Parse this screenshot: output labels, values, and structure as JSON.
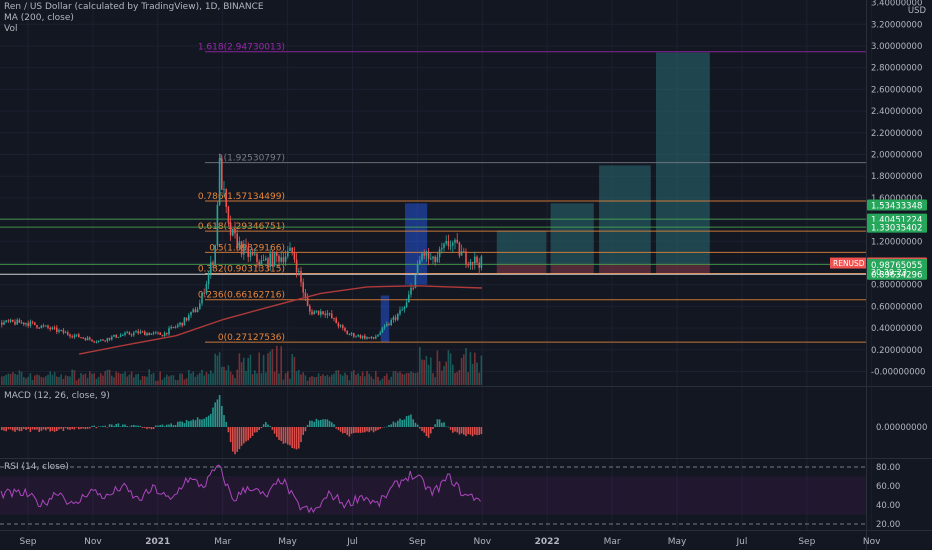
{
  "header": {
    "symbol_line": "Ren / US Dollar (calculated by TradingView), 1D, BINANCE",
    "ma_line": "MA (200, close)",
    "vol_line": "Vol"
  },
  "macd_title": "MACD (12, 26, close, 9)",
  "rsi_title": "RSI (14, close)",
  "colors": {
    "background": "#131722",
    "up": "#26a69a",
    "down": "#ef5350",
    "ma": "#b03a3a",
    "fib": "#e8863a",
    "green_line": "#4caf50",
    "target_box": "#2f7f86",
    "rsi": "#9c27b0",
    "entry_box": "#2962ff",
    "price_label": "#ef5350",
    "level_label_green": "#26a65b"
  },
  "chart_data": [
    {
      "type": "candlestick",
      "title": "",
      "ylabel": "USD",
      "ylim": [
        -0.05,
        3.4
      ],
      "y_ticks": [
        "3.40000000",
        "3.20000000",
        "3.00000000",
        "2.80000000",
        "2.60000000",
        "2.40000000",
        "2.20000000",
        "2.00000000",
        "1.80000000",
        "1.60000000",
        "1.40000000",
        "1.20000000",
        "1.00000000",
        "0.80000000",
        "0.60000000",
        "0.40000000",
        "0.20000000",
        "-0.00000000"
      ],
      "x_ticks": [
        "Sep",
        "Nov",
        "2021",
        "Mar",
        "May",
        "Jul",
        "Sep",
        "Nov",
        "2022",
        "Mar",
        "May",
        "Jul",
        "Sep",
        "Nov"
      ],
      "price_path": [
        [
          "2020-08-25",
          0.45
        ],
        [
          "2020-09-15",
          0.4
        ],
        [
          "2020-10-10",
          0.33
        ],
        [
          "2020-11-01",
          0.28
        ],
        [
          "2020-11-20",
          0.33
        ],
        [
          "2020-12-10",
          0.36
        ],
        [
          "2021-01-01",
          0.34
        ],
        [
          "2021-01-20",
          0.45
        ],
        [
          "2021-02-05",
          0.6
        ],
        [
          "2021-02-20",
          1.1
        ],
        [
          "2021-02-24",
          1.92
        ],
        [
          "2021-03-05",
          1.3
        ],
        [
          "2021-03-20",
          1.1
        ],
        [
          "2021-04-05",
          1.0
        ],
        [
          "2021-04-20",
          1.05
        ],
        [
          "2021-05-05",
          1.1
        ],
        [
          "2021-05-20",
          0.55
        ],
        [
          "2021-06-05",
          0.55
        ],
        [
          "2021-06-25",
          0.35
        ],
        [
          "2021-07-20",
          0.3
        ],
        [
          "2021-08-05",
          0.45
        ],
        [
          "2021-08-20",
          0.6
        ],
        [
          "2021-09-05",
          1.1
        ],
        [
          "2021-09-15",
          1.0
        ],
        [
          "2021-10-01",
          1.2
        ],
        [
          "2021-10-15",
          1.05
        ],
        [
          "2021-11-01",
          1.0
        ]
      ],
      "ma_path": [
        [
          "2020-10-15",
          0.16
        ],
        [
          "2020-12-01",
          0.25
        ],
        [
          "2021-01-15",
          0.33
        ],
        [
          "2021-03-01",
          0.48
        ],
        [
          "2021-04-15",
          0.6
        ],
        [
          "2021-06-01",
          0.72
        ],
        [
          "2021-07-15",
          0.78
        ],
        [
          "2021-09-01",
          0.79
        ],
        [
          "2021-10-01",
          0.78
        ],
        [
          "2021-11-01",
          0.77
        ]
      ],
      "fibonacci": [
        {
          "label": "0(0.27127536)",
          "value": 0.27127536
        },
        {
          "label": "0.236(0.66162716)",
          "value": 0.66162716
        },
        {
          "label": "0.382(0.90313315)",
          "value": 0.90313315
        },
        {
          "label": "0.5(1.09829166)",
          "value": 1.09829166
        },
        {
          "label": "0.618(1.29346751)",
          "value": 1.29346751
        },
        {
          "label": "0.786(1.57134499)",
          "value": 1.57134499
        },
        {
          "label": "1(1.92530797)",
          "value": 1.92530797
        },
        {
          "label": "1.618(2.94730013)",
          "value": 2.94730013
        }
      ],
      "horizontal_lines": [
        {
          "value": 1.40451224,
          "color": "#4caf50"
        },
        {
          "value": 1.33035402,
          "color": "#4caf50"
        },
        {
          "value": 0.98765055,
          "color": "#4caf50"
        },
        {
          "value": 0.89634296,
          "color": "#ffffff"
        }
      ],
      "price_labels": [
        {
          "text": "1.53433348",
          "value": 1.53433348,
          "color": "#26a65b"
        },
        {
          "text": "1.40451224",
          "value": 1.40451224,
          "color": "#26a65b"
        },
        {
          "text": "1.33035402",
          "value": 1.33035402,
          "color": "#26a65b"
        },
        {
          "text": "0.99954296",
          "value": 0.99954296,
          "color": "#ef5350"
        },
        {
          "text": "0.98765055",
          "value": 0.98765055,
          "color": "#26a65b"
        },
        {
          "text": "0.89634296",
          "value": 0.89634296,
          "color": "#26a65b"
        }
      ],
      "current_price": {
        "symbol": "RENUSD",
        "value": "0.99954296",
        "countdown": "20:39:23"
      },
      "entry_zone": {
        "x_start": "2021-07-28",
        "x_end": "2021-08-05",
        "low": 0.27,
        "high": 0.7
      },
      "entry_zone_2": {
        "x_start": "2021-08-20",
        "x_end": "2021-09-10",
        "low": 0.8,
        "high": 1.55
      },
      "target_boxes": [
        {
          "x_start": "2021-11-15",
          "x_end": "2022-01-01",
          "top": 1.3
        },
        {
          "x_start": "2022-01-05",
          "x_end": "2022-02-15",
          "top": 1.55
        },
        {
          "x_start": "2022-02-20",
          "x_end": "2022-04-10",
          "top": 1.9
        },
        {
          "x_start": "2022-04-15",
          "x_end": "2022-06-05",
          "top": 2.94
        }
      ],
      "target_floor": 0.99,
      "stop_floor": 0.9
    },
    {
      "type": "histogram",
      "title": "MACD (12, 26, close, 9)",
      "y_ticks": [
        "0.00000000"
      ],
      "values_path": [
        [
          "2020-08-25",
          -0.03
        ],
        [
          "2020-09-20",
          -0.03
        ],
        [
          "2020-10-20",
          -0.01
        ],
        [
          "2020-11-20",
          0.02
        ],
        [
          "2020-12-20",
          -0.01
        ],
        [
          "2021-01-20",
          0.04
        ],
        [
          "2021-02-15",
          0.1
        ],
        [
          "2021-02-24",
          0.3
        ],
        [
          "2021-03-10",
          -0.25
        ],
        [
          "2021-03-25",
          -0.1
        ],
        [
          "2021-04-10",
          0.05
        ],
        [
          "2021-04-25",
          -0.15
        ],
        [
          "2021-05-10",
          -0.2
        ],
        [
          "2021-05-20",
          0.05
        ],
        [
          "2021-06-05",
          0.08
        ],
        [
          "2021-06-25",
          -0.08
        ],
        [
          "2021-07-20",
          -0.04
        ],
        [
          "2021-08-10",
          0.05
        ],
        [
          "2021-08-25",
          0.1
        ],
        [
          "2021-09-10",
          -0.1
        ],
        [
          "2021-09-20",
          0.08
        ],
        [
          "2021-10-05",
          -0.05
        ],
        [
          "2021-10-20",
          -0.08
        ],
        [
          "2021-11-01",
          -0.07
        ]
      ]
    },
    {
      "type": "line",
      "title": "RSI (14, close)",
      "y_ticks": [
        "80.00",
        "60.00",
        "40.00",
        "20.00"
      ],
      "ylim": [
        15,
        85
      ],
      "bands": [
        30,
        70
      ],
      "values_path": [
        [
          "2020-08-25",
          52
        ],
        [
          "2020-09-10",
          40
        ],
        [
          "2020-09-25",
          55
        ],
        [
          "2020-10-10",
          38
        ],
        [
          "2020-10-25",
          56
        ],
        [
          "2020-11-10",
          48
        ],
        [
          "2020-11-25",
          60
        ],
        [
          "2020-12-10",
          45
        ],
        [
          "2020-12-25",
          58
        ],
        [
          "2021-01-10",
          44
        ],
        [
          "2021-01-25",
          68
        ],
        [
          "2021-02-10",
          60
        ],
        [
          "2021-02-24",
          82
        ],
        [
          "2021-03-10",
          45
        ],
        [
          "2021-03-25",
          60
        ],
        [
          "2021-04-10",
          48
        ],
        [
          "2021-04-25",
          68
        ],
        [
          "2021-05-10",
          40
        ],
        [
          "2021-05-25",
          32
        ],
        [
          "2021-06-10",
          52
        ],
        [
          "2021-06-25",
          40
        ],
        [
          "2021-07-10",
          50
        ],
        [
          "2021-07-25",
          40
        ],
        [
          "2021-08-10",
          60
        ],
        [
          "2021-08-25",
          72
        ],
        [
          "2021-09-05",
          65
        ],
        [
          "2021-09-15",
          52
        ],
        [
          "2021-10-01",
          70
        ],
        [
          "2021-10-15",
          50
        ],
        [
          "2021-11-01",
          47
        ]
      ]
    }
  ]
}
